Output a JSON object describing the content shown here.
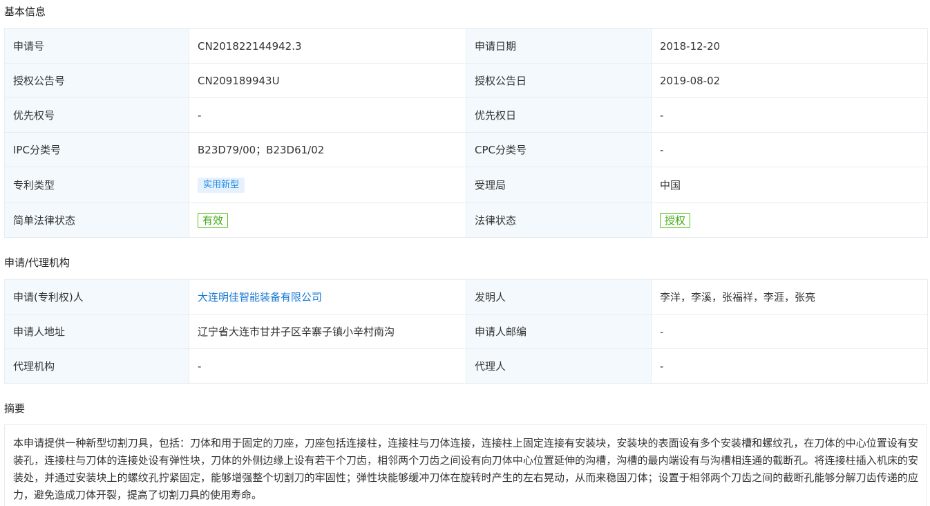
{
  "basic": {
    "title": "基本信息",
    "rows": [
      {
        "l1": "申请号",
        "v1": "CN201822144942.3",
        "l2": "申请日期",
        "v2": "2018-12-20"
      },
      {
        "l1": "授权公告号",
        "v1": "CN209189943U",
        "l2": "授权公告日",
        "v2": "2019-08-02"
      },
      {
        "l1": "优先权号",
        "v1": "-",
        "l2": "优先权日",
        "v2": "-"
      },
      {
        "l1": "IPC分类号",
        "v1": "B23D79/00；B23D61/02",
        "l2": "CPC分类号",
        "v2": "-"
      },
      {
        "l1": "专利类型",
        "v1": "实用新型",
        "l2": "受理局",
        "v2": "中国"
      },
      {
        "l1": "简单法律状态",
        "v1": "有效",
        "l2": "法律状态",
        "v2": "授权"
      }
    ]
  },
  "agency": {
    "title": "申请/代理机构",
    "rows": [
      {
        "l1": "申请(专利权)人",
        "v1": "大连明佳智能装备有限公司",
        "l2": "发明人",
        "v2": "李洋，李溪，张福祥，李涯，张亮"
      },
      {
        "l1": "申请人地址",
        "v1": "辽宁省大连市甘井子区辛寨子镇小辛村南沟",
        "l2": "申请人邮编",
        "v2": "-"
      },
      {
        "l1": "代理机构",
        "v1": "-",
        "l2": "代理人",
        "v2": "-"
      }
    ]
  },
  "abstract": {
    "title": "摘要",
    "text": "本申请提供一种新型切割刀具，包括：刀体和用于固定的刀座，刀座包括连接柱，连接柱与刀体连接，连接柱上固定连接有安装块，安装块的表面设有多个安装槽和螺纹孔，在刀体的中心位置设有安装孔，连接柱与刀体的连接处设有弹性块，刀体的外侧边缘上设有若干个刀齿，相邻两个刀齿之间设有向刀体中心位置延伸的沟槽，沟槽的最内端设有与沟槽相连通的截断孔。将连接柱插入机床的安装处，并通过安装块上的螺纹孔拧紧固定，能够增强整个切割刀的牢固性；弹性块能够缓冲刀体在旋转时产生的左右晃动，从而来稳固刀体；设置于相邻两个刀齿之间的截断孔能够分解刀齿传递的应力，避免造成刀体开裂，提高了切割刀具的使用寿命。"
  },
  "colors": {
    "label_bg": "#f3f9fd",
    "border": "#e6ecf0",
    "link": "#1677d2",
    "tag_blue_bg": "#e5f1fc",
    "tag_blue_text": "#1e88e5",
    "tag_green": "#52c41a"
  }
}
